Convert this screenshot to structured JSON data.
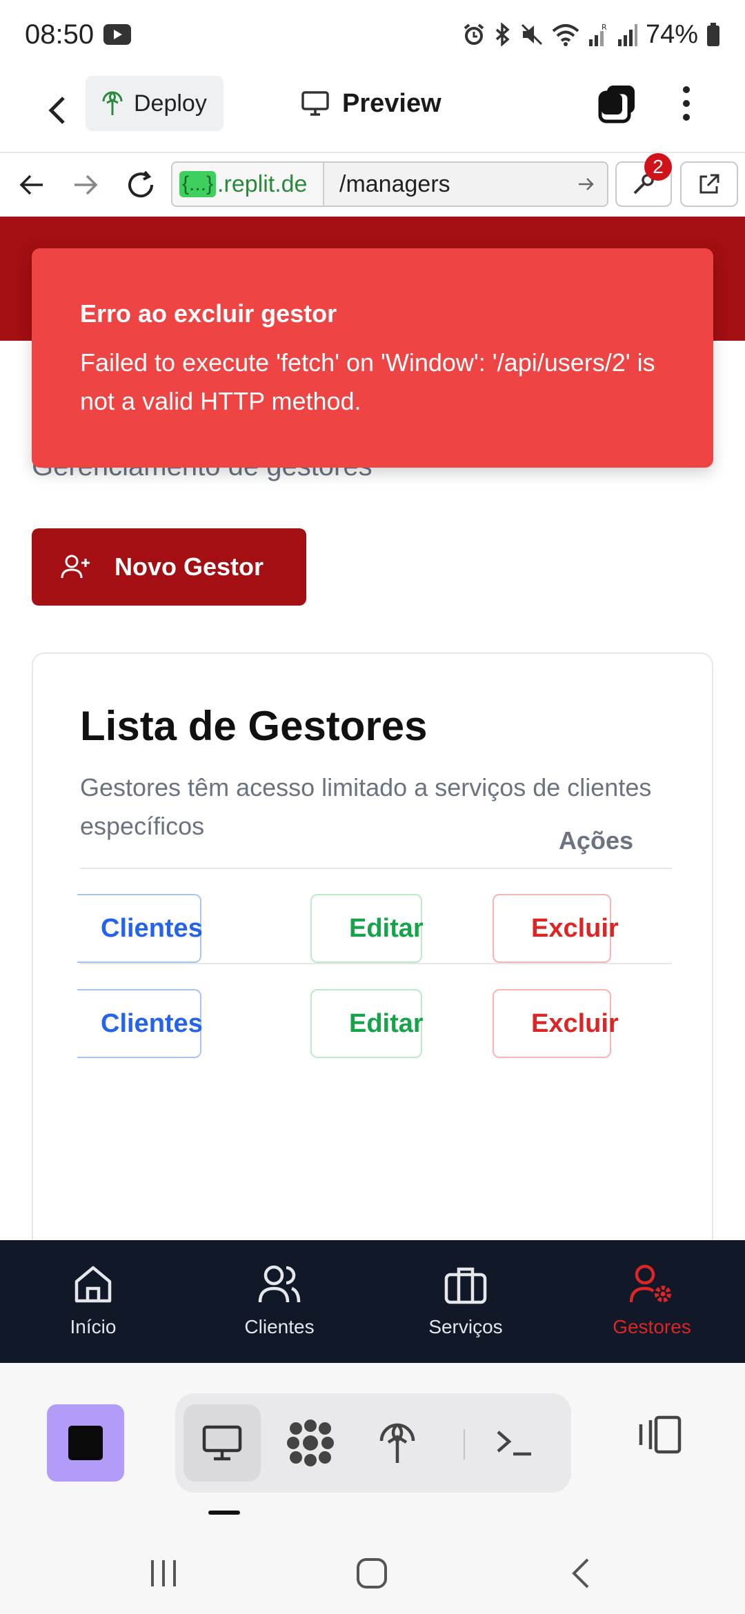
{
  "status_bar": {
    "time": "08:50",
    "battery": "74%"
  },
  "app_bar": {
    "deploy_label": "Deploy",
    "preview_label": "Preview"
  },
  "browser": {
    "host_badge": "{...}",
    "host": ".replit.de",
    "path": "/managers",
    "devtools_count": "2"
  },
  "toast": {
    "title": "Erro ao excluir gestor",
    "message": "Failed to execute 'fetch' on 'Window': '/api/users/2' is not a valid HTTP method."
  },
  "page": {
    "subtitle": "Gerenciamento de gestores",
    "new_button": "Novo Gestor",
    "card_title": "Lista de Gestores",
    "card_desc": "Gestores têm acesso limitado a serviços de clientes específicos",
    "actions_header": "Ações",
    "rows": [
      {
        "clients": "Clientes",
        "edit": "Editar",
        "delete": "Excluir"
      },
      {
        "clients": "Clientes",
        "edit": "Editar",
        "delete": "Excluir"
      }
    ]
  },
  "bottom_nav": {
    "items": [
      {
        "label": "Início",
        "icon": "home-icon"
      },
      {
        "label": "Clientes",
        "icon": "users-icon"
      },
      {
        "label": "Serviços",
        "icon": "briefcase-icon"
      },
      {
        "label": "Gestores",
        "icon": "user-gear-icon",
        "active": true
      }
    ]
  },
  "colors": {
    "brand_red": "#a30f12",
    "toast_red": "#ef4444",
    "nav_bg": "#111827",
    "stop_purple": "#b39cf7"
  }
}
